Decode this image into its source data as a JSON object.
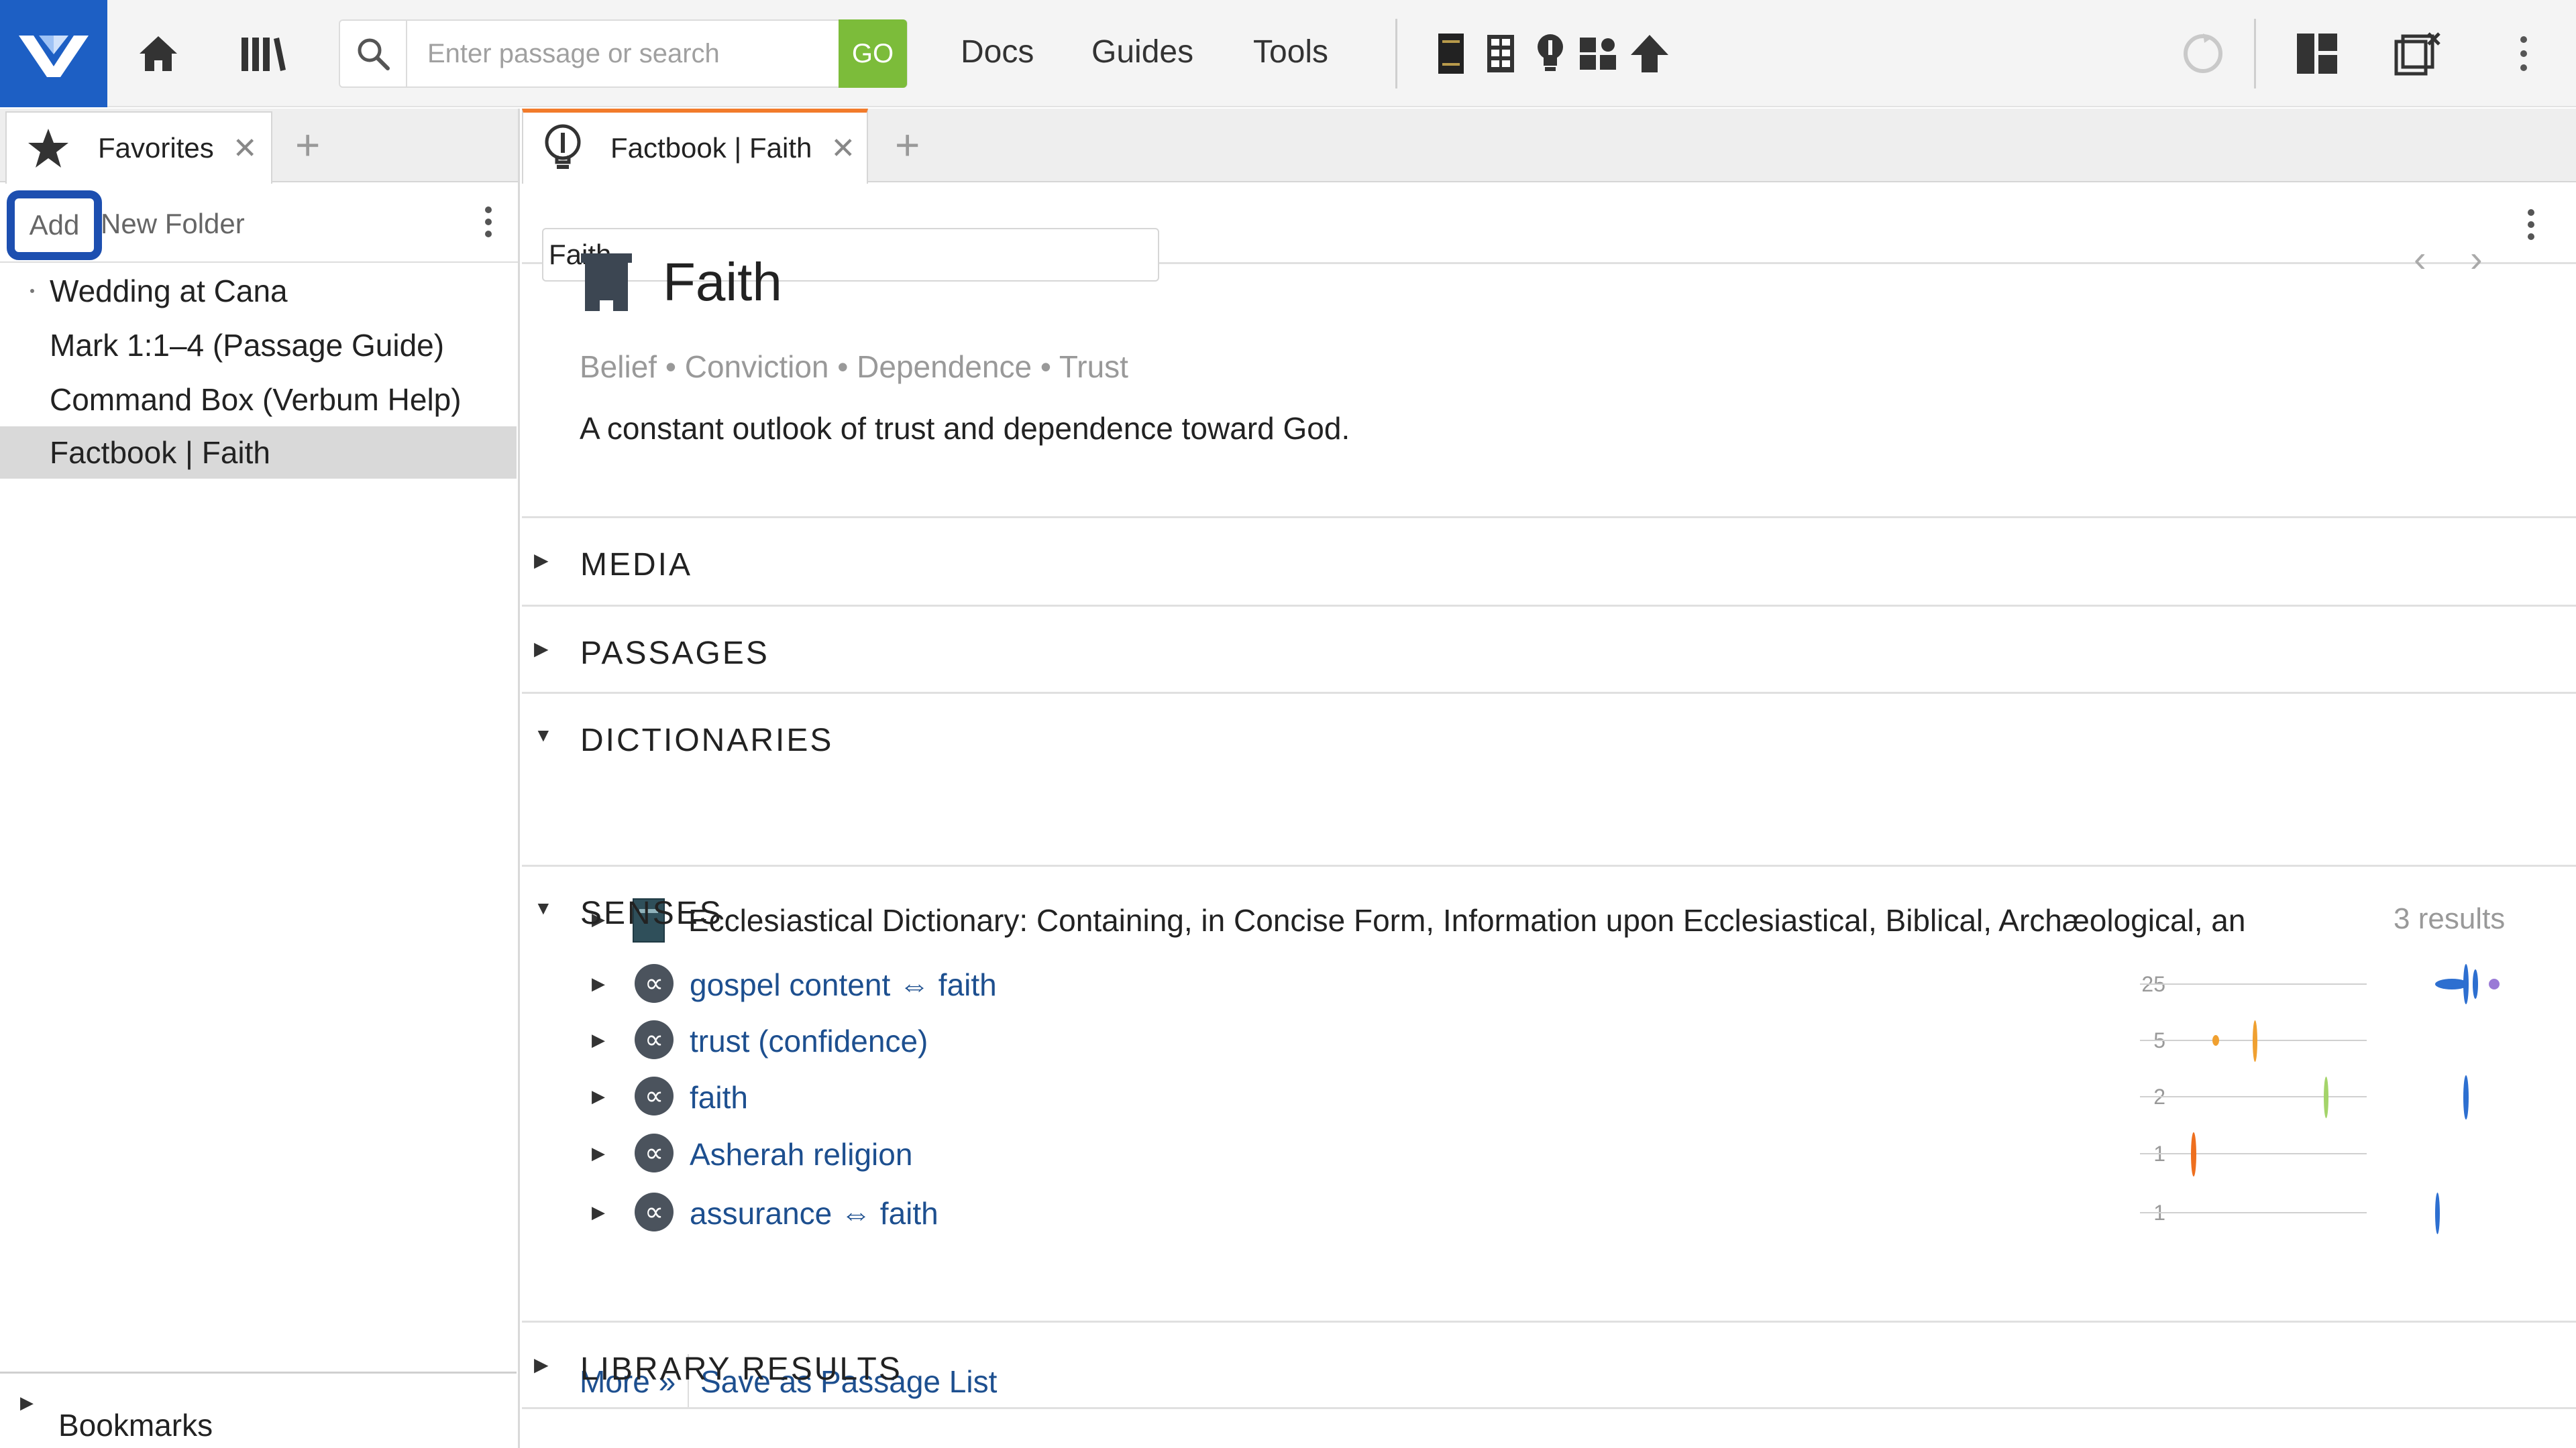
{
  "topbar": {
    "search_placeholder": "Enter passage or search",
    "go_label": "GO",
    "menu": [
      "Docs",
      "Guides",
      "Tools"
    ]
  },
  "left": {
    "tab_label": "Favorites",
    "add_label": "Add",
    "new_folder_label": "New Folder",
    "items": [
      "Wedding at Cana",
      "Mark 1:1–4 (Passage Guide)",
      "Command Box (Verbum Help)",
      "Factbook | Faith"
    ],
    "selected_index": 3,
    "bookmarks_label": "Bookmarks"
  },
  "right": {
    "tab_label": "Factbook | Faith",
    "search_value": "Faith",
    "title": "Faith",
    "synonyms": "Belief • Conviction • Dependence • Trust",
    "definition": "A constant outlook of trust and dependence toward God.",
    "sections": {
      "media": "MEDIA",
      "passages": "PASSAGES",
      "dictionaries": "DICTIONARIES",
      "senses": "SENSES",
      "library_results": "LIBRARY RESULTS"
    },
    "dictionary": {
      "title": "Ecclesiastical Dictionary: Containing, in Concise Form, Information upon Ecclesiastical, Biblical, Archæological, and Histo…",
      "count": "3 results"
    },
    "senses": [
      {
        "label": "gospel content ⇔ faith",
        "count": "25"
      },
      {
        "label": "trust (confidence)",
        "count": "5"
      },
      {
        "label": "faith",
        "count": "2"
      },
      {
        "label": "Asherah religion",
        "count": "1"
      },
      {
        "label": "assurance ⇔ faith",
        "count": "1"
      }
    ],
    "more_label": "More »",
    "save_label": "Save as Passage List"
  },
  "colors": {
    "brand": "#1d5fc4",
    "go_green": "#7cbc3a",
    "active_tab_accent": "#f27b2b",
    "link": "#1d4f8f"
  }
}
